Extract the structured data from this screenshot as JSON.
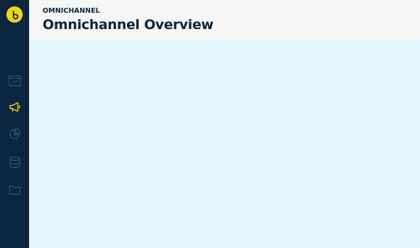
{
  "header": {
    "eyebrow": "OMNICHANNEL",
    "title": "Omnichannel Overview"
  },
  "sidebar": {
    "items": [
      {
        "icon": "dashboard-icon",
        "active": false
      },
      {
        "icon": "megaphone-icon",
        "active": true
      },
      {
        "icon": "pie-chart-icon",
        "active": false
      },
      {
        "icon": "database-icon",
        "active": false
      },
      {
        "icon": "folder-icon",
        "active": false
      }
    ]
  },
  "colors": {
    "sidebar_bg": "#0b2540",
    "accent": "#f5d21a",
    "header_bg": "#f6f6f6",
    "content_bg": "#e3f6fd",
    "icon_inactive": "#3a536d"
  }
}
